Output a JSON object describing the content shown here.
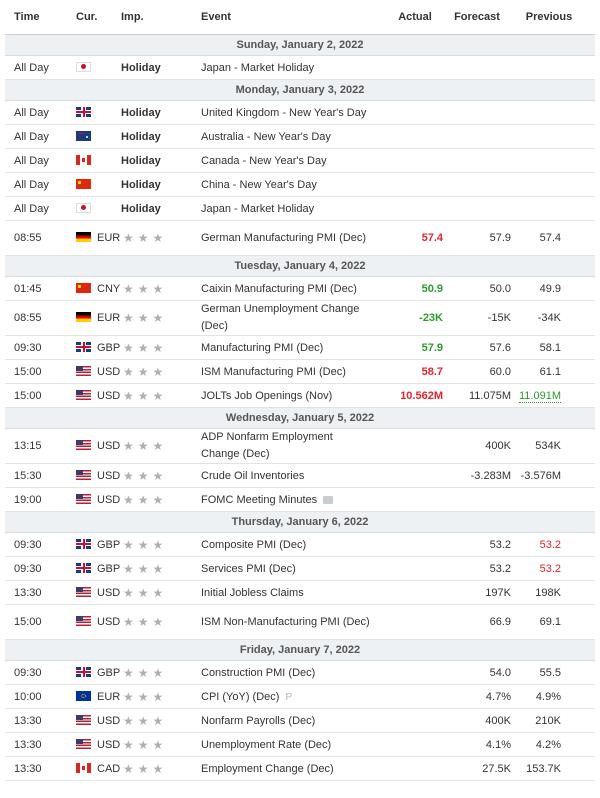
{
  "headers": {
    "time": "Time",
    "cur": "Cur.",
    "imp": "Imp.",
    "event": "Event",
    "actual": "Actual",
    "forecast": "Forecast",
    "previous": "Previous"
  },
  "days": [
    {
      "label": "Sunday, January 2, 2022",
      "rows": [
        {
          "time": "All Day",
          "flag": "jp",
          "cur": "",
          "imp": "Holiday",
          "event": "Japan - Market Holiday",
          "actual": "",
          "forecast": "",
          "previous": ""
        }
      ]
    },
    {
      "label": "Monday, January 3, 2022",
      "rows": [
        {
          "time": "All Day",
          "flag": "gb",
          "cur": "",
          "imp": "Holiday",
          "event": "United Kingdom - New Year's Day",
          "actual": "",
          "forecast": "",
          "previous": ""
        },
        {
          "time": "All Day",
          "flag": "au",
          "cur": "",
          "imp": "Holiday",
          "event": "Australia - New Year's Day",
          "actual": "",
          "forecast": "",
          "previous": ""
        },
        {
          "time": "All Day",
          "flag": "ca",
          "cur": "",
          "imp": "Holiday",
          "event": "Canada - New Year's Day",
          "actual": "",
          "forecast": "",
          "previous": ""
        },
        {
          "time": "All Day",
          "flag": "cn",
          "cur": "",
          "imp": "Holiday",
          "event": "China - New Year's Day",
          "actual": "",
          "forecast": "",
          "previous": ""
        },
        {
          "time": "All Day",
          "flag": "jp",
          "cur": "",
          "imp": "Holiday",
          "event": "Japan - Market Holiday",
          "actual": "",
          "forecast": "",
          "previous": ""
        },
        {
          "time": "08:55",
          "flag": "de",
          "cur": "EUR",
          "imp": "",
          "event": "German Manufacturing PMI (Dec)",
          "actual": "57.4",
          "actual_color": "red",
          "forecast": "57.9",
          "previous": "57.4",
          "tall": true
        }
      ]
    },
    {
      "label": "Tuesday, January 4, 2022",
      "rows": [
        {
          "time": "01:45",
          "flag": "cn",
          "cur": "CNY",
          "imp": "",
          "event": "Caixin Manufacturing PMI (Dec)",
          "actual": "50.9",
          "actual_color": "green",
          "forecast": "50.0",
          "previous": "49.9"
        },
        {
          "time": "08:55",
          "flag": "de",
          "cur": "EUR",
          "imp": "",
          "event": "German Unemployment Change (Dec)",
          "actual": "-23K",
          "actual_color": "green",
          "forecast": "-15K",
          "previous": "-34K",
          "tall": true
        },
        {
          "time": "09:30",
          "flag": "gb",
          "cur": "GBP",
          "imp": "",
          "event": "Manufacturing PMI (Dec)",
          "actual": "57.9",
          "actual_color": "green",
          "forecast": "57.6",
          "previous": "58.1"
        },
        {
          "time": "15:00",
          "flag": "us",
          "cur": "USD",
          "imp": "",
          "event": "ISM Manufacturing PMI (Dec)",
          "actual": "58.7",
          "actual_color": "red",
          "forecast": "60.0",
          "previous": "61.1"
        },
        {
          "time": "15:00",
          "flag": "us",
          "cur": "USD",
          "imp": "",
          "event": "JOLTs Job Openings (Nov)",
          "actual": "10.562M",
          "actual_color": "red",
          "forecast": "11.075M",
          "previous": "11.091M",
          "prev_color": "green"
        }
      ]
    },
    {
      "label": "Wednesday, January 5, 2022",
      "rows": [
        {
          "time": "13:15",
          "flag": "us",
          "cur": "USD",
          "imp": "",
          "event": "ADP Nonfarm Employment Change (Dec)",
          "actual": "",
          "forecast": "400K",
          "previous": "534K",
          "tall": true
        },
        {
          "time": "15:30",
          "flag": "us",
          "cur": "USD",
          "imp": "",
          "event": "Crude Oil Inventories",
          "actual": "",
          "forecast": "-3.283M",
          "previous": "-3.576M"
        },
        {
          "time": "19:00",
          "flag": "us",
          "cur": "USD",
          "imp": "",
          "event": "FOMC Meeting Minutes",
          "actual": "",
          "forecast": "",
          "previous": "",
          "doc": true
        }
      ]
    },
    {
      "label": "Thursday, January 6, 2022",
      "rows": [
        {
          "time": "09:30",
          "flag": "gb",
          "cur": "GBP",
          "imp": "",
          "event": "Composite PMI (Dec)",
          "actual": "",
          "forecast": "53.2",
          "previous": "53.2",
          "prev_color": "red"
        },
        {
          "time": "09:30",
          "flag": "gb",
          "cur": "GBP",
          "imp": "",
          "event": "Services PMI (Dec)",
          "actual": "",
          "forecast": "53.2",
          "previous": "53.2",
          "prev_color": "red"
        },
        {
          "time": "13:30",
          "flag": "us",
          "cur": "USD",
          "imp": "",
          "event": "Initial Jobless Claims",
          "actual": "",
          "forecast": "197K",
          "previous": "198K"
        },
        {
          "time": "15:00",
          "flag": "us",
          "cur": "USD",
          "imp": "",
          "event": "ISM Non-Manufacturing PMI (Dec)",
          "actual": "",
          "forecast": "66.9",
          "previous": "69.1",
          "tall": true
        }
      ]
    },
    {
      "label": "Friday, January 7, 2022",
      "rows": [
        {
          "time": "09:30",
          "flag": "gb",
          "cur": "GBP",
          "imp": "",
          "event": "Construction PMI (Dec)",
          "actual": "",
          "forecast": "54.0",
          "previous": "55.5"
        },
        {
          "time": "10:00",
          "flag": "eu",
          "cur": "EUR",
          "imp": "",
          "event": "CPI (YoY) (Dec)",
          "actual": "",
          "forecast": "4.7%",
          "previous": "4.9%",
          "prelim": "P"
        },
        {
          "time": "13:30",
          "flag": "us",
          "cur": "USD",
          "imp": "",
          "event": "Nonfarm Payrolls (Dec)",
          "actual": "",
          "forecast": "400K",
          "previous": "210K"
        },
        {
          "time": "13:30",
          "flag": "us",
          "cur": "USD",
          "imp": "",
          "event": "Unemployment Rate (Dec)",
          "actual": "",
          "forecast": "4.1%",
          "previous": "4.2%"
        },
        {
          "time": "13:30",
          "flag": "ca",
          "cur": "CAD",
          "imp": "",
          "event": "Employment Change (Dec)",
          "actual": "",
          "forecast": "27.5K",
          "previous": "153.7K"
        }
      ]
    }
  ]
}
